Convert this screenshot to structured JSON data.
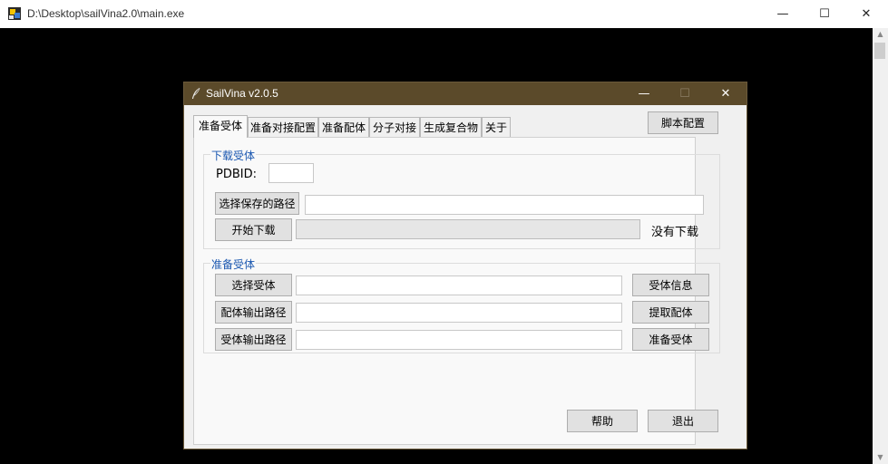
{
  "console": {
    "title": "D:\\Desktop\\sailVina2.0\\main.exe",
    "minimize": "—",
    "maximize": "☐",
    "close": "✕"
  },
  "app": {
    "title": "SailVina v2.0.5",
    "minimize": "—",
    "maximize": "☐",
    "close": "✕",
    "tabs": [
      "准备受体",
      "准备对接配置",
      "准备配体",
      "分子对接",
      "生成复合物",
      "关于"
    ],
    "script_config_button": "脚本配置",
    "download_group": {
      "title": "下载受体",
      "pdbid_label": "PDBID:",
      "pdbid_value": "",
      "choose_path_button": "选择保存的路径",
      "path_value": "",
      "start_download_button": "开始下载",
      "download_progress": 0,
      "status": "没有下载"
    },
    "prepare_group": {
      "title": "准备受体",
      "choose_receptor_button": "选择受体",
      "receptor_value": "",
      "receptor_info_button": "受体信息",
      "ligand_output_button": "配体输出路径",
      "ligand_output_value": "",
      "extract_ligand_button": "提取配体",
      "receptor_output_button": "受体输出路径",
      "receptor_output_value": "",
      "prepare_receptor_button": "准备受体"
    },
    "help_button": "帮助",
    "exit_button": "退出"
  }
}
